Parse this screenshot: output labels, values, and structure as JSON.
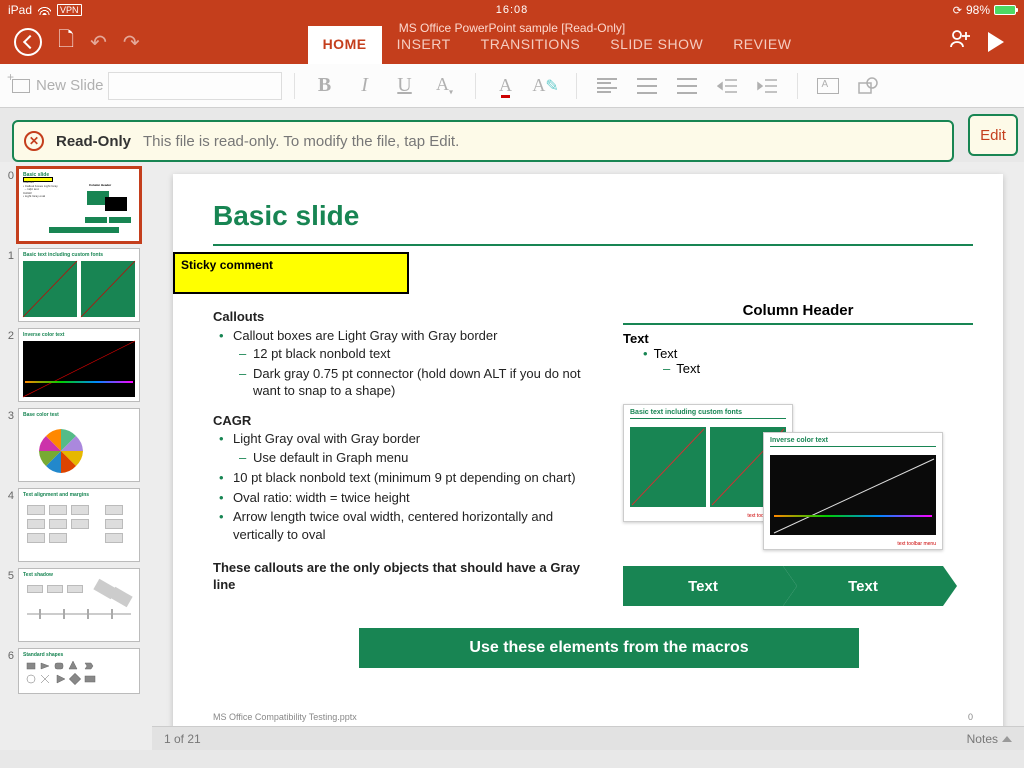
{
  "statusbar": {
    "device": "iPad",
    "vpn": "VPN",
    "time": "16:08",
    "battery_pct": "98%"
  },
  "app": {
    "title": "MS Office PowerPoint sample [Read-Only]"
  },
  "tabs": {
    "home": "HOME",
    "insert": "INSERT",
    "transitions": "TRANSITIONS",
    "slideshow": "SLIDE SHOW",
    "review": "REVIEW"
  },
  "ribbon": {
    "new_slide": "New Slide"
  },
  "readonly": {
    "title": "Read-Only",
    "msg": "This file is read-only. To modify the file, tap Edit.",
    "edit": "Edit"
  },
  "thumbnails": {
    "count_label": "1 of 21",
    "notes_label": "Notes",
    "slides": [
      {
        "num": "0",
        "title": "Basic slide"
      },
      {
        "num": "1",
        "title": "Basic text including custom fonts"
      },
      {
        "num": "2",
        "title": "Inverse color text"
      },
      {
        "num": "3",
        "title": "Base color test"
      },
      {
        "num": "4",
        "title": "Text alignment and margins"
      },
      {
        "num": "5",
        "title": "Text shadow"
      },
      {
        "num": "6",
        "title": "Standard shapes"
      }
    ]
  },
  "slide": {
    "title": "Basic slide",
    "sticky": "Sticky comment",
    "sec1": "Callouts",
    "s1_b1": "Callout boxes are Light Gray with Gray border",
    "s1_b1a": "12 pt black nonbold text",
    "s1_b1b": "Dark gray 0.75 pt connector (hold down ALT if you do not want to snap to a shape)",
    "sec2": "CAGR",
    "s2_b1": "Light Gray oval with Gray border",
    "s2_b1a": "Use default in Graph menu",
    "s2_b2": "10 pt black nonbold text (minimum 9 pt depending on chart)",
    "s2_b3": "Oval ratio: width = twice height",
    "s2_b4": "Arrow length twice oval width, centered horizontally and vertically to oval",
    "closing": "These callouts are the only objects that should have a Gray line",
    "col_header": "Column Header",
    "rtext": "Text",
    "rtext_b1": "Text",
    "rtext_b1a": "Text",
    "chev1": "Text",
    "chev2": "Text",
    "banner": "Use these elements from the macros",
    "mini1_title": "Basic text including custom fonts",
    "mini2_title": "Inverse color text",
    "footer_file": "MS Office Compatibility Testing.pptx",
    "footer_page": "0"
  }
}
